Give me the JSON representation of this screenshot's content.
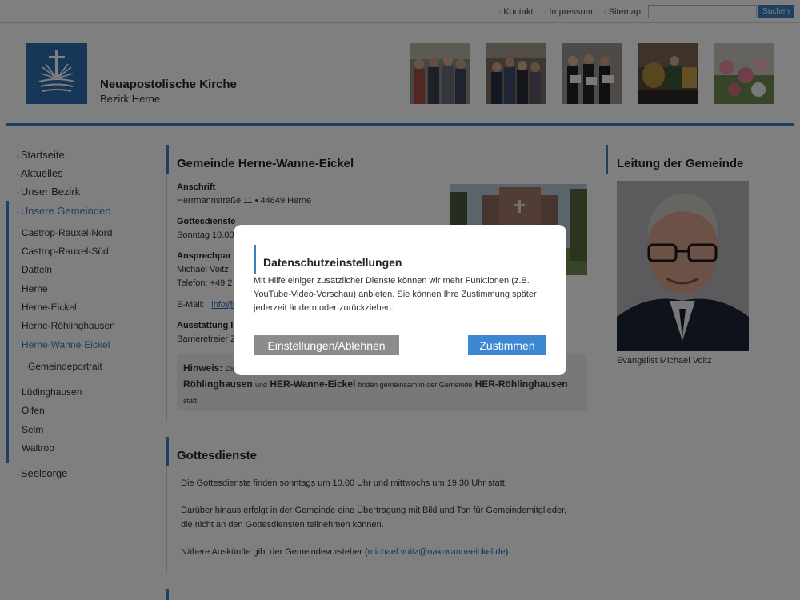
{
  "topbar": {
    "links": [
      "Kontakt",
      "Impressum",
      "Sitemap"
    ],
    "search_placeholder": "",
    "search_button": "Suchen"
  },
  "header": {
    "title": "Neuapostolische Kirche",
    "subtitle": "Bezirk Herne"
  },
  "nav": {
    "top_items": [
      "Startseite",
      "Aktuelles",
      "Unser Bezirk",
      "Unsere Gemeinden"
    ],
    "sub_items": [
      "Castrop-Rauxel-Nord",
      "Castrop-Rauxel-Süd",
      "Datteln",
      "Herne",
      "Herne-Eickel",
      "Herne-Röhlinghausen",
      "Herne-Wanne-Eickel"
    ],
    "subsub_item": "Gemeindeportrait",
    "sub_items_2": [
      "Lüdinghausen",
      "Olfen",
      "Selm",
      "Waltrop"
    ],
    "last_item": "Seelsorge"
  },
  "main": {
    "heading": "Gemeinde Herne-Wanne-Eickel",
    "address_label": "Anschrift",
    "address_value": "Herrmannstraße 11  •  44649 Herne",
    "services_label": "Gottesdienste",
    "services_value": "Sonntag 10.00",
    "contact_label": "Ansprechpar",
    "contact_name": "Michael Voitz",
    "contact_phone": "Telefon: +49 2",
    "email_label": "E-Mail:",
    "email_value": "info@",
    "equipment_label": "Ausstattung I",
    "equipment_value": "Barrierefreier Z",
    "hint_bold": "Hinweis:",
    "hint_small_1": "Die",
    "hint_name_1": "Röhlinghausen",
    "hint_small_2": "und",
    "hint_name_2": "HER-Wanne-Eickel",
    "hint_small_3": "finden gemeinsam in der Gemeinde",
    "hint_name_3": "HER-Röhlinghausen",
    "hint_small_4": "statt.",
    "services_heading": "Gottesdienste",
    "p1": "Die Gottesdienste finden sonntags um 10.00 Uhr und mittwochs um 19.30 Uhr statt.",
    "p2_line1": "Darüber hinaus erfolgt in der Gemeinde eine Übertragung mit Bild und Ton für Gemeindemitglieder,",
    "p2_line2": "die nicht an den Gottesdiensten teilnehmen können.",
    "p3_before": "Nähere Auskünfte gibt der Gemeindevorsteher (",
    "p3_link": "michael.voitz@nak-wanneeickel.de",
    "p3_after": ")."
  },
  "right": {
    "heading": "Leitung der Gemeinde",
    "caption": "Evangelist Michael Voitz"
  },
  "dialog": {
    "title": "Datenschutzeinstellungen",
    "text": "Mit Hilfe einiger zusätzlicher Dienste können wir mehr Funktionen (z.B. YouTube-Video-Vorschau) anbieten. Sie können Ihre Zustimmung später jederzeit ändern oder zurückziehen.",
    "settings_button": "Einstellungen/Ablehnen",
    "accept_button": "Zustimmen"
  },
  "colors": {
    "accent": "#3d7fc1",
    "overlay": "rgba(0,0,0,0.5)",
    "button_grey": "#8c8c8c",
    "button_blue": "#3d86d2"
  }
}
